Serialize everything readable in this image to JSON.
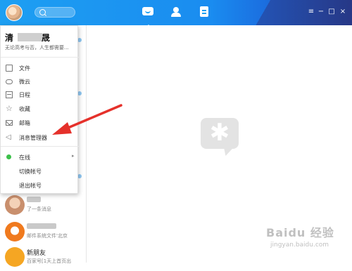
{
  "profile": {
    "name_start": "清",
    "name_end": "晟",
    "signature": "无论高考与否，人生都需要..."
  },
  "menu": {
    "items": [
      {
        "label": "文件",
        "icon": "folder-icon"
      },
      {
        "label": "微云",
        "icon": "cloud-icon"
      },
      {
        "label": "日程",
        "icon": "calendar-icon"
      },
      {
        "label": "收藏",
        "icon": "star-icon"
      },
      {
        "label": "邮箱",
        "icon": "mail-icon"
      },
      {
        "label": "消息管理器",
        "icon": "speaker-icon"
      }
    ],
    "status": {
      "label": "在线",
      "color": "#3cc04a",
      "arrow": "▸"
    },
    "switch_account": "切换帐号",
    "logout": "退出帐号"
  },
  "list": {
    "item1_sub": "了一条消息",
    "item2_sub": "邮件系统文件'北京",
    "new_friends": {
      "name": "新朋友",
      "sub": "百家号[1天上首页出"
    }
  },
  "window_buttons": {
    "menu": "≡",
    "min": "−",
    "max": "□",
    "close": "×"
  },
  "colors": {
    "accent": "#1d9ff2",
    "arrow": "#e5312b"
  },
  "watermark": {
    "brand": "Baidu 经验",
    "site": "jingyan.baidu.com"
  }
}
